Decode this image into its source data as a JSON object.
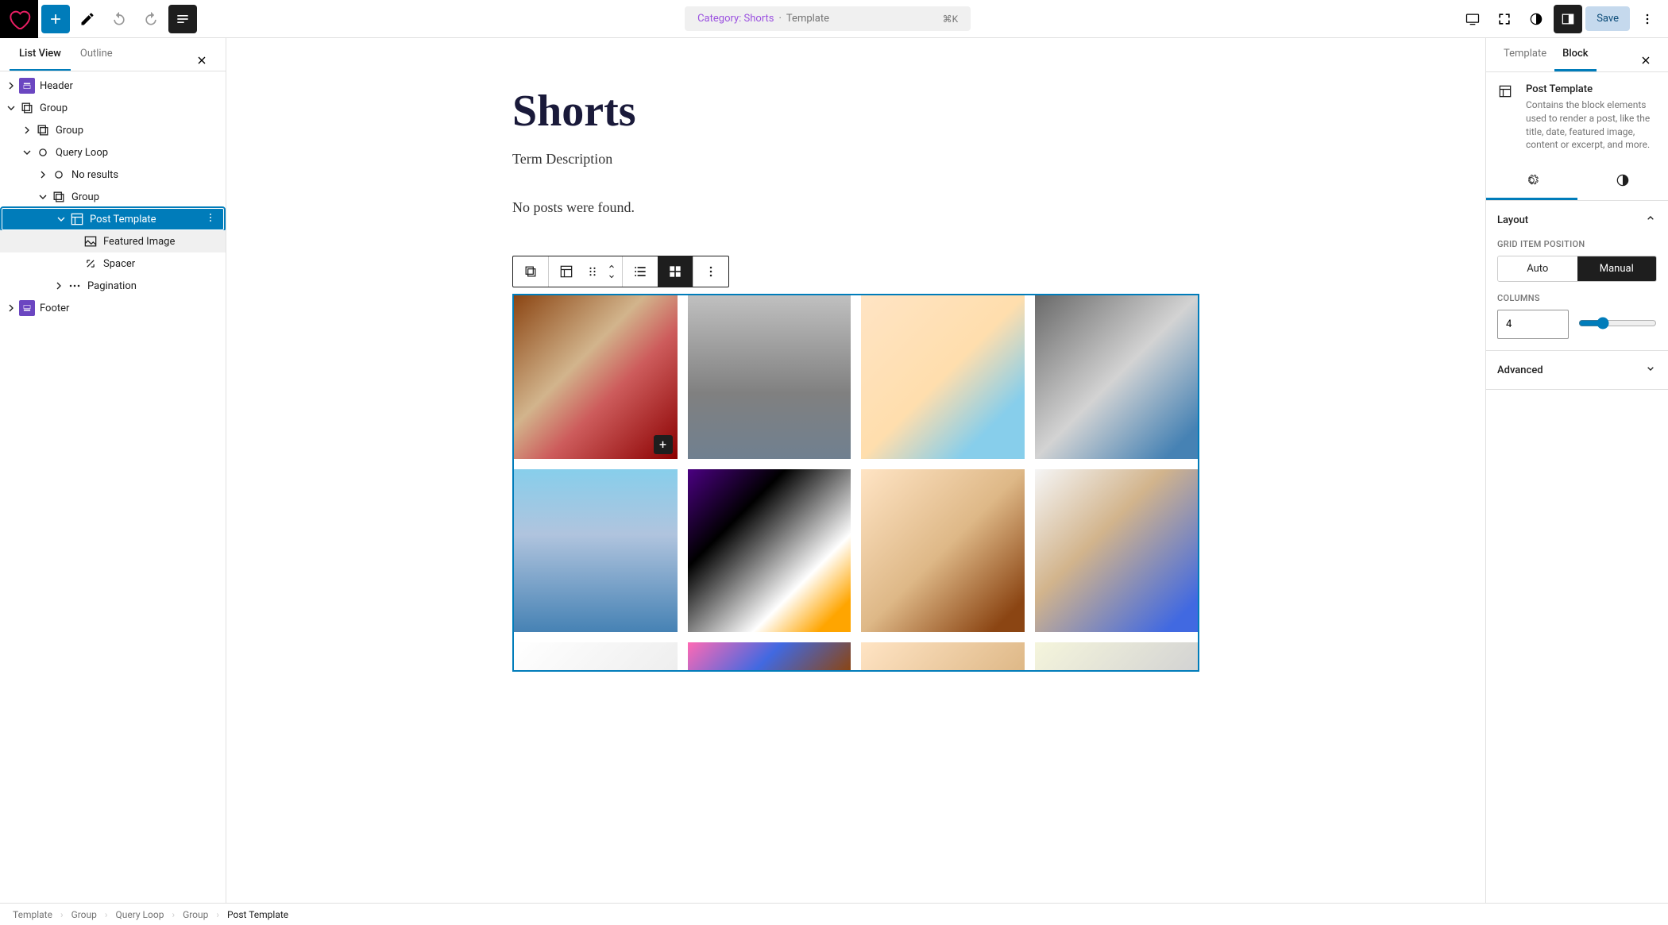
{
  "topbar": {
    "command": {
      "category_label": "Category: Shorts",
      "separator": " · ",
      "template": "Template",
      "shortcut": "⌘K"
    },
    "save_label": "Save"
  },
  "sidebar_left": {
    "tabs": {
      "list_view": "List View",
      "outline": "Outline"
    },
    "tree": {
      "header": "Header",
      "group1": "Group",
      "group2": "Group",
      "query_loop": "Query Loop",
      "no_results": "No results",
      "group3": "Group",
      "post_template": "Post Template",
      "featured_image": "Featured Image",
      "spacer": "Spacer",
      "pagination": "Pagination",
      "footer": "Footer"
    }
  },
  "canvas": {
    "title": "Shorts",
    "term_description": "Term Description",
    "no_posts": "No posts were found."
  },
  "sidebar_right": {
    "tabs": {
      "template": "Template",
      "block": "Block"
    },
    "block_name": "Post Template",
    "block_desc": "Contains the block elements used to render a post, like the title, date, featured image, content or excerpt, and more.",
    "panels": {
      "layout": "Layout",
      "grid_item_position": "GRID ITEM POSITION",
      "auto": "Auto",
      "manual": "Manual",
      "columns": "COLUMNS",
      "columns_value": "4",
      "advanced": "Advanced"
    }
  },
  "breadcrumb": [
    "Template",
    "Group",
    "Query Loop",
    "Group",
    "Post Template"
  ]
}
